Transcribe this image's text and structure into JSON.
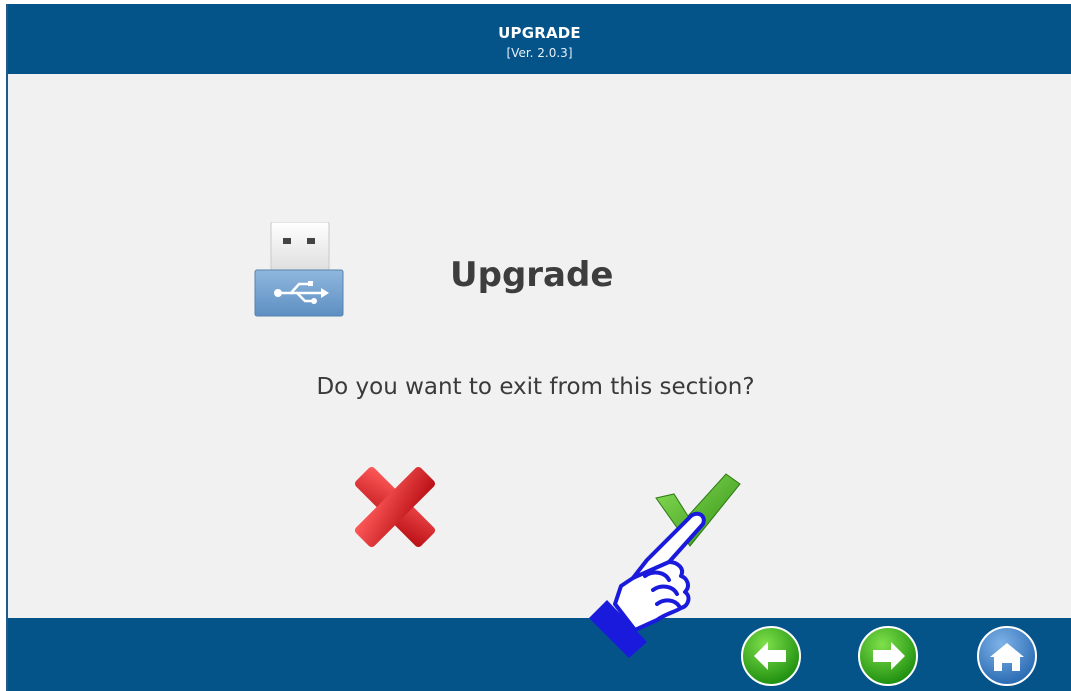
{
  "header": {
    "title": "UPGRADE",
    "version": "[Ver. 2.0.3]"
  },
  "dialog": {
    "title": "Upgrade",
    "message": "Do you want to exit from this section?",
    "icon": "usb-drive-icon"
  },
  "actions": {
    "cancel_icon": "red-x-icon",
    "confirm_icon": "green-check-icon"
  },
  "footer": {
    "back_icon": "green-left-arrow-icon",
    "forward_icon": "green-right-arrow-icon",
    "home_icon": "home-icon"
  },
  "colors": {
    "bar": "#04548a",
    "background": "#f1f1f1",
    "text": "#3a3a3a",
    "cancel": "#d8202a",
    "confirm": "#4caf1f"
  }
}
